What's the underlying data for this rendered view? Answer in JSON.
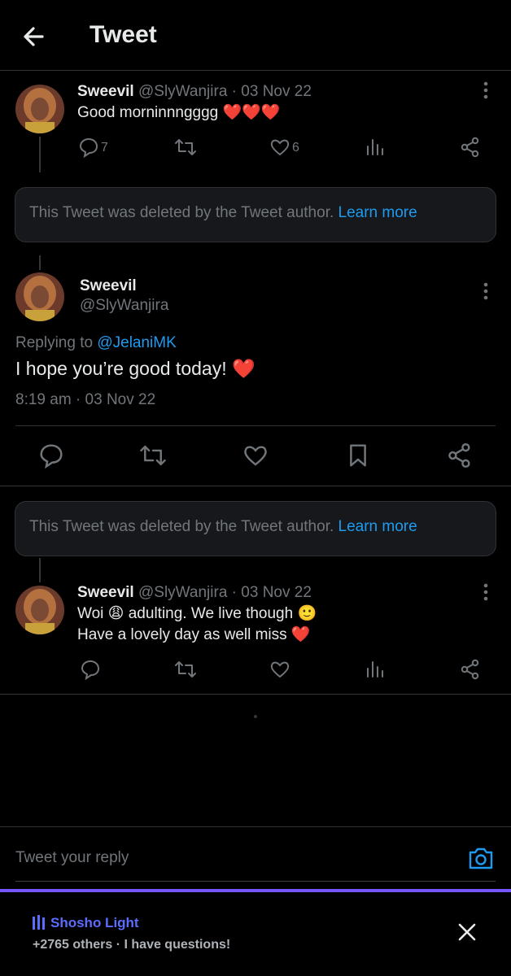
{
  "header": {
    "title": "Tweet",
    "back_icon": "arrow-left-icon"
  },
  "tweet1": {
    "name": "Sweevil",
    "handle": "@SlyWanjira",
    "date": "· 03 Nov 22",
    "text": "Good morninnngggg",
    "hearts": "❤️❤️❤️",
    "replies": "7",
    "likes": "6"
  },
  "deleted_notice": {
    "text": "This Tweet was deleted by the Tweet author.",
    "link": "Learn more"
  },
  "main_tweet": {
    "name": "Sweevil",
    "handle": "@SlyWanjira",
    "replying_label": "Replying to",
    "replying_to": "@JelaniMK",
    "text": "I hope you’re good today!",
    "heart": "❤️",
    "timestamp": "8:19 am · 03 Nov 22"
  },
  "tweet2": {
    "name": "Sweevil",
    "handle": "@SlyWanjira",
    "date": "· 03 Nov 22",
    "line1": "Woi 😩 adulting. We live though 🙂",
    "line2": "Have a lovely day as well miss ❤️"
  },
  "reply_box": {
    "placeholder": "Tweet your reply",
    "camera_icon": "camera-icon"
  },
  "promo": {
    "name": "Shosho Light",
    "subtitle": "+2765 others · I have questions!"
  },
  "colors": {
    "accent": "#1d9bf0",
    "background": "#000000",
    "muted": "#71767b",
    "promo": "#7856ff"
  }
}
